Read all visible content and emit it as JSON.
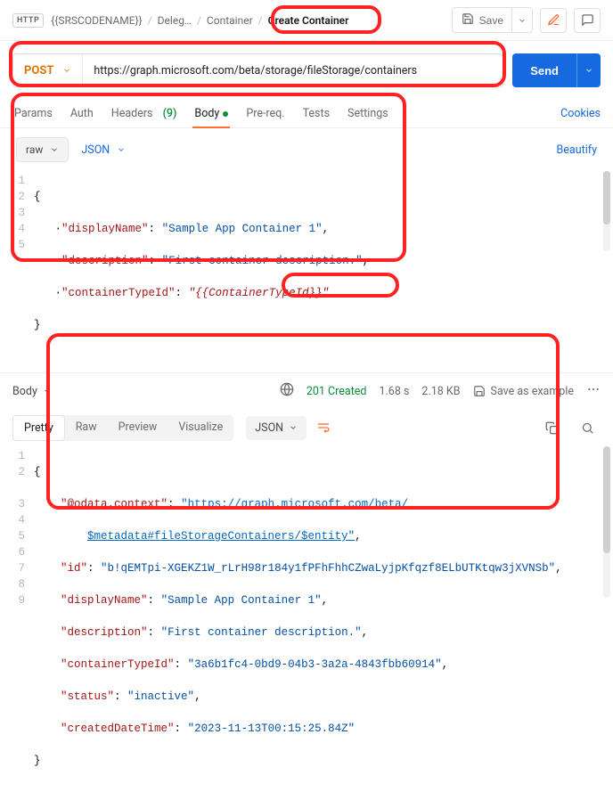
{
  "header": {
    "http_badge": "HTTP",
    "breadcrumb": {
      "item1": "{{SRSCODENAME}}",
      "item2": "Deleg…",
      "item3": "Container",
      "current": "Create Container"
    },
    "save_label": "Save"
  },
  "request": {
    "method": "POST",
    "url": "https://graph.microsoft.com/beta/storage/fileStorage/containers",
    "send": "Send"
  },
  "tabs": {
    "params": "Params",
    "auth": "Auth",
    "headers": "Headers",
    "headers_count": "(9)",
    "body": "Body",
    "prereq": "Pre-req.",
    "tests": "Tests",
    "settings": "Settings",
    "cookies": "Cookies"
  },
  "body_controls": {
    "raw": "raw",
    "json": "JSON",
    "beautify": "Beautify"
  },
  "request_body_lines": {
    "l1": "{",
    "l2_key": "\"displayName\"",
    "l2_val": "\"Sample App Container 1\"",
    "l3_key": "\"description\"",
    "l3_val": "\"First container description.\"",
    "l4_key": "\"containerTypeId\"",
    "l4_val": "\"{{ContainerTypeId}}\"",
    "l5": "}"
  },
  "response": {
    "body_tab": "Body",
    "status": "201 Created",
    "time": "1.68 s",
    "size": "2.18 KB",
    "save_example": "Save as example",
    "views": {
      "pretty": "Pretty",
      "raw": "Raw",
      "preview": "Preview",
      "visualize": "Visualize",
      "json": "JSON"
    }
  },
  "response_body": {
    "l2_key": "\"@odata.context\"",
    "l2_val_a": "\"https://graph.microsoft.com/beta/",
    "l2_val_b": "$metadata#fileStorageContainers/$entity\"",
    "l3_key": "\"id\"",
    "l3_val": "\"b!qEMTpi-XGEKZ1W_rLrH98r184y1fPFhFhhCZwaLyjpKfqzf8ELbUTKtqw3jXVNSb\"",
    "l4_key": "\"displayName\"",
    "l4_val": "\"Sample App Container 1\"",
    "l5_key": "\"description\"",
    "l5_val": "\"First container description.\"",
    "l6_key": "\"containerTypeId\"",
    "l6_val": "\"3a6b1fc4-0bd9-04b3-3a2a-4843fbb60914\"",
    "l7_key": "\"status\"",
    "l7_val": "\"inactive\"",
    "l8_key": "\"createdDateTime\"",
    "l8_val": "\"2023-11-13T00:15:25.84Z\""
  }
}
